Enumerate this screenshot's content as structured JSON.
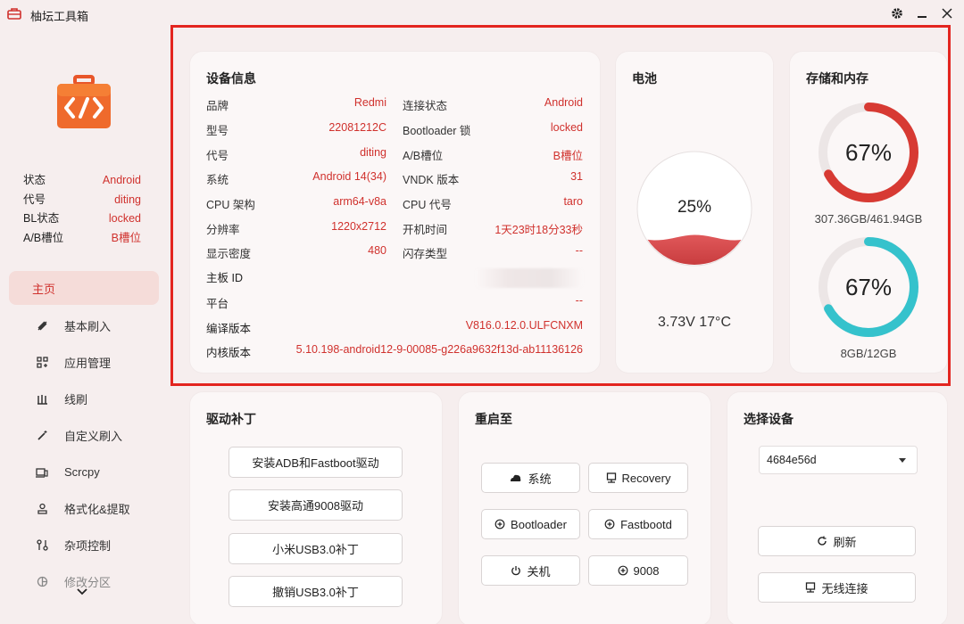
{
  "app": {
    "title": "柚坛工具箱"
  },
  "sidebar": {
    "status": [
      {
        "label": "状态",
        "value": "Android"
      },
      {
        "label": "代号",
        "value": "diting"
      },
      {
        "label": "BL状态",
        "value": "locked"
      },
      {
        "label": "A/B槽位",
        "value": "B槽位"
      }
    ],
    "nav": [
      {
        "label": "主页",
        "icon": "home"
      },
      {
        "label": "基本刷入",
        "icon": "flash-icon"
      },
      {
        "label": "应用管理",
        "icon": "apps-icon"
      },
      {
        "label": "线刷",
        "icon": "cable-icon"
      },
      {
        "label": "自定义刷入",
        "icon": "wand-icon"
      },
      {
        "label": "Scrcpy",
        "icon": "screen-icon"
      },
      {
        "label": "格式化&提取",
        "icon": "format-icon"
      },
      {
        "label": "杂项控制",
        "icon": "misc-icon"
      },
      {
        "label": "修改分区",
        "icon": "partition-icon"
      }
    ]
  },
  "device_info": {
    "title": "设备信息",
    "left": [
      {
        "label": "品牌",
        "value": "Redmi"
      },
      {
        "label": "型号",
        "value": "22081212C"
      },
      {
        "label": "代号",
        "value": "diting"
      },
      {
        "label": "系统",
        "value": "Android 14(34)"
      },
      {
        "label": "CPU 架构",
        "value": "arm64-v8a"
      },
      {
        "label": "分辨率",
        "value": "1220x2712"
      },
      {
        "label": "显示密度",
        "value": "480"
      }
    ],
    "right": [
      {
        "label": "连接状态",
        "value": "Android"
      },
      {
        "label": "Bootloader 锁",
        "value": "locked"
      },
      {
        "label": "A/B槽位",
        "value": "B槽位"
      },
      {
        "label": "VNDK 版本",
        "value": "31"
      },
      {
        "label": "CPU 代号",
        "value": "taro"
      },
      {
        "label": "开机时间",
        "value": "1天23时18分33秒"
      },
      {
        "label": "闪存类型",
        "value": "--"
      }
    ],
    "board_id": {
      "label": "主板 ID"
    },
    "platform": {
      "label": "平台",
      "value": "--"
    },
    "build": {
      "label": "编译版本",
      "value": "V816.0.12.0.ULFCNXM"
    },
    "kernel": {
      "label": "内核版本",
      "value": "5.10.198-android12-9-00085-g226a9632f13d-ab11136126"
    }
  },
  "battery": {
    "title": "电池",
    "level_percent": 25,
    "level_text": "25%",
    "status": "3.73V 17°C"
  },
  "storage": {
    "title": "存储和内存",
    "storage_percent": 67,
    "storage_text": "67%",
    "storage_detail": "307.36GB/461.94GB",
    "memory_percent": 67,
    "memory_text": "67%",
    "memory_detail": "8GB/12GB"
  },
  "driver": {
    "title": "驱动补丁",
    "buttons": [
      "安装ADB和Fastboot驱动",
      "安装高通9008驱动",
      "小米USB3.0补丁",
      "撤销USB3.0补丁"
    ]
  },
  "reboot": {
    "title": "重启至",
    "buttons": [
      "系统",
      "Recovery",
      "Bootloader",
      "Fastbootd",
      "关机",
      "9008"
    ]
  },
  "device_select": {
    "title": "选择设备",
    "selected": "4684e56d",
    "refresh": "刷新",
    "wireless": "无线连接"
  },
  "colors": {
    "accent": "#d0312d",
    "teal": "#35c2cc",
    "highlight": "#e3251f"
  }
}
